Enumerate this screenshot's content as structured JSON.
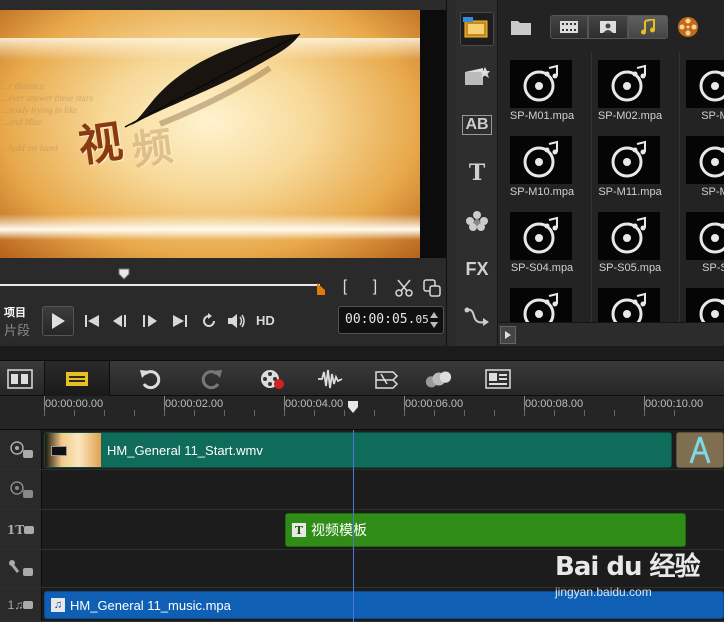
{
  "preview": {
    "overlay_chars": [
      "视",
      "频"
    ],
    "poem_lines": [
      "...r distance",
      "...ever answer these stars",
      "...ready trying to like",
      "...and Mize",
      "...hold my hand"
    ],
    "mode_project": "项目",
    "mode_clip": "片段",
    "hd_label": "HD",
    "timecode": "00:00:05.",
    "timecode_frames": "05",
    "trim_in": "[",
    "trim_out": "]",
    "scrub_position": 0.29
  },
  "library": {
    "items": [
      {
        "name": "SP-M01.mpa"
      },
      {
        "name": "SP-M02.mpa"
      },
      {
        "name": "SP-M0"
      },
      {
        "name": "SP-M10.mpa"
      },
      {
        "name": "SP-M11.mpa"
      },
      {
        "name": "SP-M1"
      },
      {
        "name": "SP-S04.mpa"
      },
      {
        "name": "SP-S05.mpa"
      },
      {
        "name": "SP-S0"
      },
      {
        "name": ""
      },
      {
        "name": ""
      },
      {
        "name": ""
      }
    ],
    "sidebar": [
      "media-icon",
      "instant-project-icon",
      "transition-icon",
      "title-icon",
      "graphic-icon",
      "filter-icon",
      "path-icon"
    ],
    "fx_label": "FX",
    "ab_label": "AB",
    "t_label": "T",
    "active_filter": "audio"
  },
  "timeline": {
    "ruler": [
      "00:00:00.00",
      "00:00:02.00",
      "00:00:04.00",
      "00:00:06.00",
      "00:00:08.00",
      "00:00:10.00"
    ],
    "ruler_seconds": [
      0,
      2,
      4,
      6,
      8,
      10
    ],
    "video_clip": "HM_General 11_Start.wmv",
    "title_clip": "视频模板",
    "music_clip": "HM_General 11_music.mpa",
    "title_track_label": "1T",
    "music_track_label": "1♫",
    "zoom_label": "+/–"
  },
  "watermark": {
    "logo_text": "Bai du 经验",
    "site": "jingyan.baidu.com"
  },
  "colors": {
    "video_clip": "#0f6b5a",
    "title_clip": "#2f8c17",
    "music_clip": "#0f5fb5",
    "playhead": "#4a78d8",
    "accent": "#e8c020"
  }
}
